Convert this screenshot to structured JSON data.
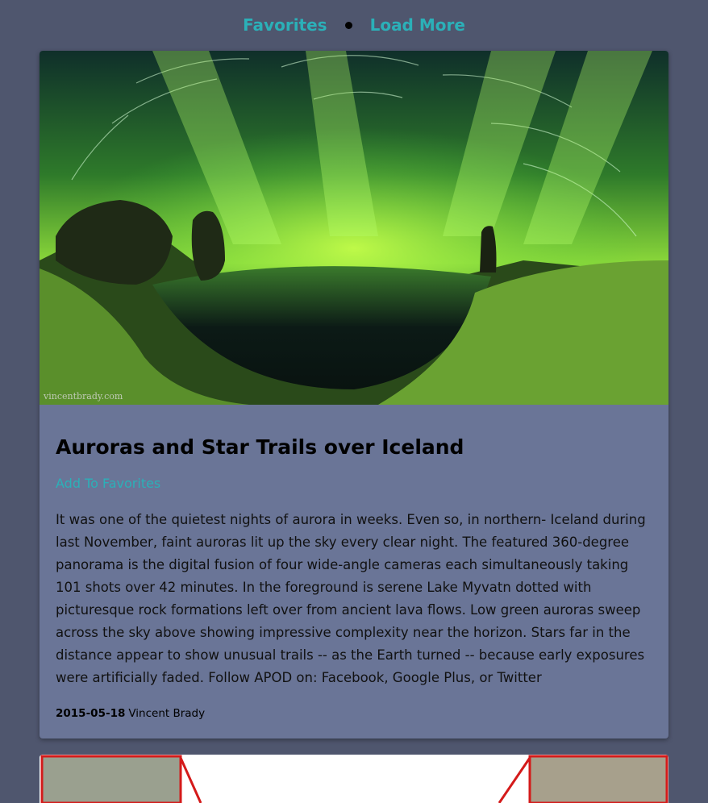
{
  "nav": {
    "favorites_label": "Favorites",
    "load_more_label": "Load More"
  },
  "post": {
    "title": "Auroras and Star Trails over Iceland",
    "add_favorites_label": "Add To Favorites",
    "description": "It was one of the quietest nights of aurora in weeks. Even so, in northern- Iceland during last November, faint auroras lit up the sky every clear night. The featured 360-degree panorama is the digital fusion of four wide-angle cameras each simultaneously taking 101 shots over 42 minutes. In the foreground is serene Lake Myvatn dotted with picturesque rock formations left over from ancient lava flows. Low green auroras sweep across the sky above showing impressive complexity near the horizon. Stars far in the distance appear to show unusual trails -- as the Earth turned -- because early exposures were artificially faded. Follow APOD on: Facebook, Google Plus, or Twitter",
    "date": "2015-05-18",
    "author": "Vincent Brady",
    "image_watermark": "vincentbrady.com"
  },
  "colors": {
    "page_bg": "#4f566e",
    "card_bg": "#6a7597",
    "link": "#2bb0b8",
    "aurora": "#7fe23a"
  }
}
